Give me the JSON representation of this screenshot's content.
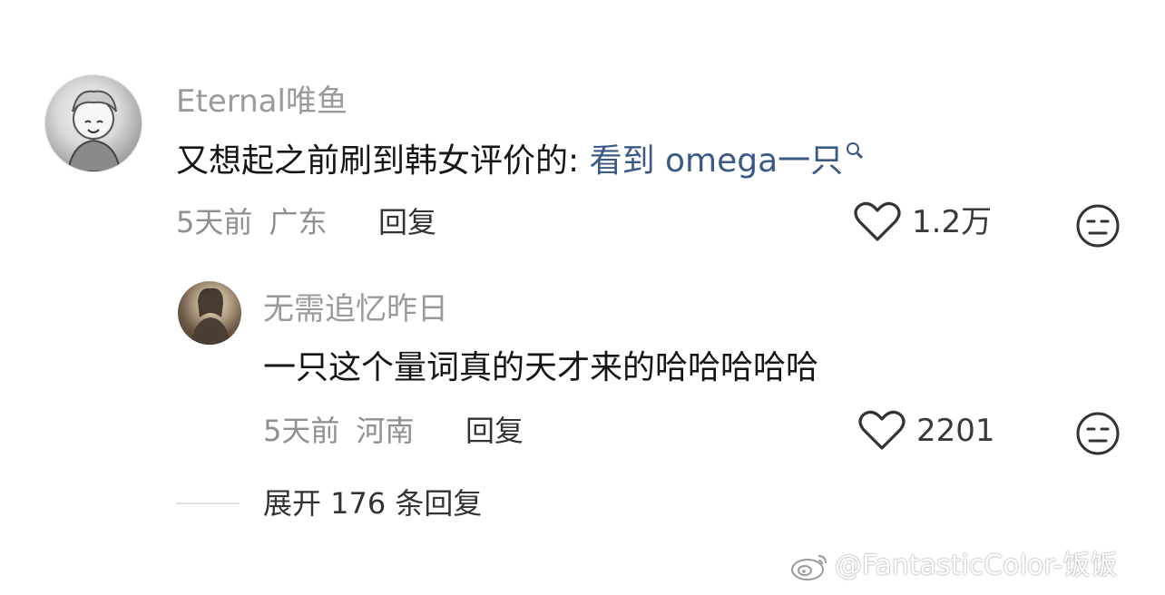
{
  "comment": {
    "username": "Eternal唯鱼",
    "text_prefix": "又想起之前刷到韩女评价的: ",
    "keyword": "看到 omega一只",
    "time": "5天前",
    "location": "广东",
    "reply_label": "回复",
    "likes": "1.2万",
    "dislike_icon": "neutral-face-icon",
    "like_icon": "heart-outline-icon"
  },
  "reply": {
    "username": "无需追忆昨日",
    "text": "一只这个量词真的天才来的哈哈哈哈哈",
    "time": "5天前",
    "location": "河南",
    "reply_label": "回复",
    "likes": "2201",
    "dislike_icon": "neutral-face-icon",
    "like_icon": "heart-outline-icon"
  },
  "expand": {
    "label": "展开 176 条回复"
  },
  "watermark": {
    "text": "@FantasticColor-饭饭",
    "icon": "weibo-logo-icon"
  },
  "colors": {
    "keyword": "#3a5a86",
    "username": "#9a9a9a",
    "meta": "#8f8f8f",
    "background": "#ffffff"
  }
}
